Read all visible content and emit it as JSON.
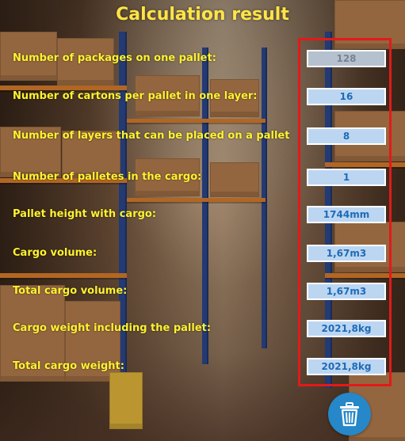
{
  "title": "Calculation result",
  "rows": [
    {
      "label": "Number of packages on one pallet:",
      "value": "128"
    },
    {
      "label": "Number of cartons per pallet in one layer:",
      "value": "16"
    },
    {
      "label": "Number of layers that can be placed on a pallet",
      "value": "8"
    },
    {
      "label": "Number of palletes in the cargo:",
      "value": "1"
    },
    {
      "label": "Pallet height with cargo:",
      "value": "1744mm"
    },
    {
      "label": "Cargo volume:",
      "value": "1,67m3"
    },
    {
      "label": "Total cargo volume:",
      "value": "1,67m3"
    },
    {
      "label": "Cargo weight including the pallet:",
      "value": "2021,8kg"
    },
    {
      "label": "Total cargo weight:",
      "value": "2021,8kg"
    }
  ],
  "colors": {
    "title": "#ffe545",
    "label": "#fff32f",
    "value_text": "#1f6bb5",
    "value_bg": "#bcd6f2",
    "highlight": "#e21a1a",
    "trash_button": "#2687c9"
  },
  "icons": {
    "delete": "trash-icon"
  }
}
